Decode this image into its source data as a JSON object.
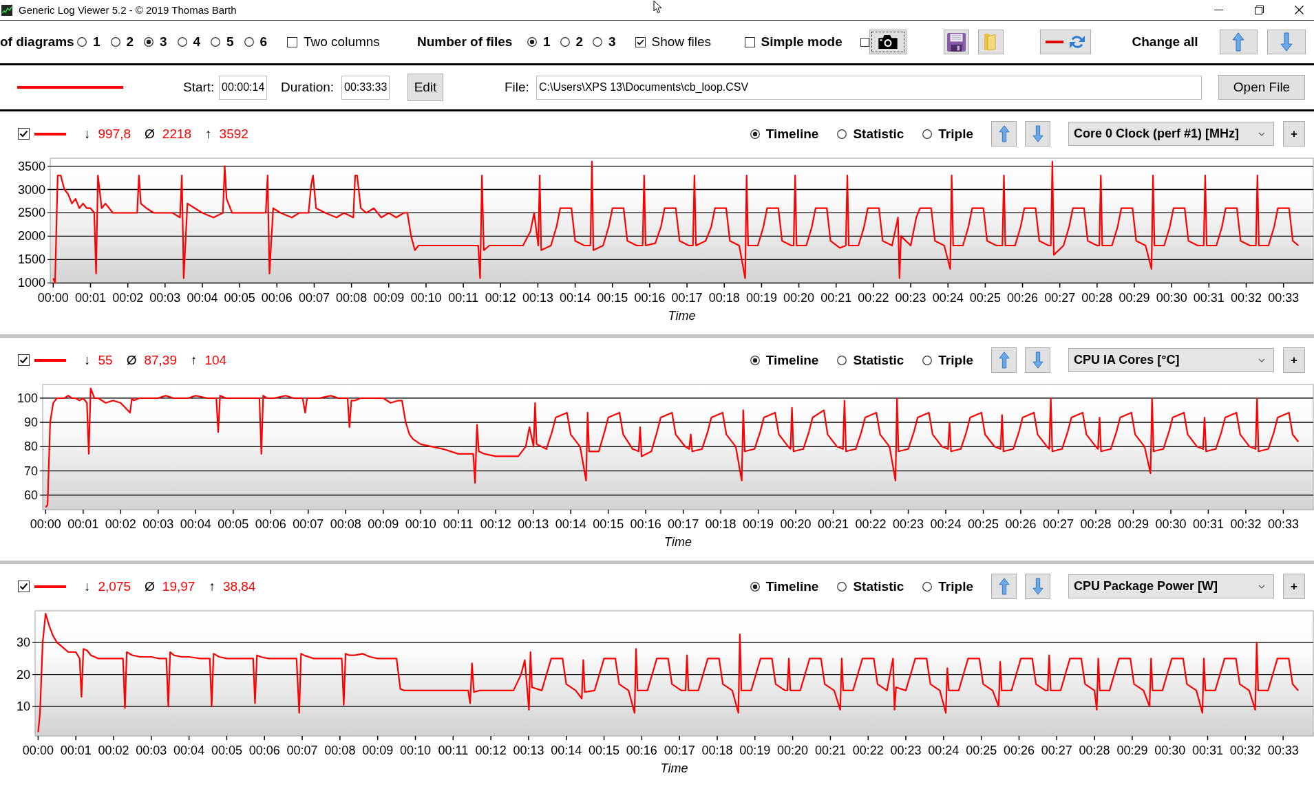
{
  "window": {
    "title": "Generic Log Viewer 5.2 - © 2019 Thomas Barth"
  },
  "toolbar": {
    "diagrams_label": "of diagrams",
    "diagram_counts": [
      {
        "label": "1",
        "selected": false
      },
      {
        "label": "2",
        "selected": false
      },
      {
        "label": "3",
        "selected": true
      },
      {
        "label": "4",
        "selected": false
      },
      {
        "label": "5",
        "selected": false
      },
      {
        "label": "6",
        "selected": false
      }
    ],
    "two_columns": {
      "label": "Two columns",
      "checked": false
    },
    "files_label": "Number of files",
    "file_counts": [
      {
        "label": "1",
        "selected": true
      },
      {
        "label": "2",
        "selected": false
      },
      {
        "label": "3",
        "selected": false
      }
    ],
    "show_files": {
      "label": "Show files",
      "checked": true
    },
    "simple_mode": {
      "label": "Simple mode",
      "checked": false
    },
    "screenshot": {
      "checked": false,
      "focused": true
    },
    "change_all_label": "Change all"
  },
  "files": [
    {
      "color": "#ff0000",
      "start_label": "Start:",
      "start": "00:00:14",
      "duration_label": "Duration:",
      "duration": "00:33:33",
      "edit_button": "Edit",
      "file_label": "File:",
      "path": "C:\\Users\\XPS 13\\Documents\\cb_loop.CSV",
      "open_button": "Open File"
    }
  ],
  "diagrams": [
    {
      "checked": true,
      "stats": [
        {
          "symbol": "↓",
          "value": "997,8"
        },
        {
          "symbol": "Ø",
          "value": "2218"
        },
        {
          "symbol": "↑",
          "value": "3592"
        }
      ],
      "modes": [
        {
          "label": "Timeline",
          "selected": true
        },
        {
          "label": "Statistic",
          "selected": false
        },
        {
          "label": "Triple",
          "selected": false
        }
      ],
      "sensor": "Core 0 Clock (perf #1) [MHz]",
      "add_button": "+",
      "chart_data": {
        "type": "line",
        "xlabel": "Time",
        "grid": true,
        "xlim": [
          -0.08,
          33.8
        ],
        "ylim": [
          990,
          3670
        ],
        "yticks": [
          1000,
          1500,
          2000,
          2500,
          3000,
          3500
        ],
        "xticks": [
          {
            "value": 0,
            "label": "00:00"
          },
          {
            "value": 1,
            "label": "00:01"
          },
          {
            "value": 2,
            "label": "00:02"
          },
          {
            "value": 3,
            "label": "00:03"
          },
          {
            "value": 4,
            "label": "00:04"
          },
          {
            "value": 5,
            "label": "00:05"
          },
          {
            "value": 6,
            "label": "00:06"
          },
          {
            "value": 7,
            "label": "00:07"
          },
          {
            "value": 8,
            "label": "00:08"
          },
          {
            "value": 9,
            "label": "00:09"
          },
          {
            "value": 10,
            "label": "00:10"
          },
          {
            "value": 11,
            "label": "00:11"
          },
          {
            "value": 12,
            "label": "00:12"
          },
          {
            "value": 13,
            "label": "00:13"
          },
          {
            "value": 14,
            "label": "00:14"
          },
          {
            "value": 15,
            "label": "00:15"
          },
          {
            "value": 16,
            "label": "00:16"
          },
          {
            "value": 17,
            "label": "00:17"
          },
          {
            "value": 18,
            "label": "00:18"
          },
          {
            "value": 19,
            "label": "00:19"
          },
          {
            "value": 20,
            "label": "00:20"
          },
          {
            "value": 21,
            "label": "00:21"
          },
          {
            "value": 22,
            "label": "00:22"
          },
          {
            "value": 23,
            "label": "00:23"
          },
          {
            "value": 24,
            "label": "00:24"
          },
          {
            "value": 25,
            "label": "00:25"
          },
          {
            "value": 26,
            "label": "00:26"
          },
          {
            "value": 27,
            "label": "00:27"
          },
          {
            "value": 28,
            "label": "00:28"
          },
          {
            "value": 29,
            "label": "00:29"
          },
          {
            "value": 30,
            "label": "00:30"
          },
          {
            "value": 31,
            "label": "00:31"
          },
          {
            "value": 32,
            "label": "00:32"
          },
          {
            "value": 33,
            "label": "00:33"
          }
        ],
        "x": [
          0,
          0.05,
          0.12,
          0.2,
          0.3,
          0.4,
          0.5,
          0.6,
          0.7,
          0.8,
          0.9,
          1,
          1.1,
          1.15,
          1.2,
          1.3,
          1.4,
          1.6,
          1.8,
          2,
          2.25,
          2.3,
          2.35,
          2.5,
          2.7,
          3,
          3.2,
          3.4,
          3.45,
          3.5,
          3.6,
          3.8,
          4,
          4.3,
          4.55,
          4.6,
          4.65,
          4.8,
          5,
          5.3,
          5.7,
          5.75,
          5.8,
          5.9,
          6.1,
          6.4,
          6.6,
          6.85,
          6.92,
          6.97,
          7.05,
          7.3,
          7.6,
          7.8,
          8.05,
          8.1,
          8.15,
          8.25,
          8.4,
          8.6,
          8.8,
          9,
          9.2,
          9.4,
          9.5,
          9.6,
          9.7,
          9.8,
          10,
          10.3,
          10.6,
          11,
          11.4,
          11.45,
          11.5,
          11.55,
          11.7,
          12,
          12.3,
          12.6,
          12.8,
          12.9,
          13.01,
          13.05,
          13.09,
          13.35,
          13.5,
          13.6,
          13.9,
          14,
          14.25,
          14.41,
          14.45,
          14.49,
          14.75,
          14.9,
          15,
          15.3,
          15.4,
          15.65,
          15.81,
          15.85,
          15.89,
          16.15,
          16.3,
          16.4,
          16.7,
          16.8,
          17.05,
          17.16,
          17.2,
          17.24,
          17.5,
          17.65,
          17.75,
          18.05,
          18.15,
          18.4,
          18.56,
          18.6,
          18.64,
          18.9,
          19.05,
          19.15,
          19.45,
          19.55,
          19.8,
          19.86,
          19.9,
          19.94,
          20.2,
          20.35,
          20.45,
          20.75,
          20.85,
          21.1,
          21.26,
          21.3,
          21.34,
          21.6,
          21.75,
          21.85,
          22.15,
          22.25,
          22.5,
          22.66,
          22.7,
          22.74,
          23,
          23.15,
          23.25,
          23.55,
          23.65,
          23.9,
          24.06,
          24.1,
          24.14,
          24.4,
          24.55,
          24.65,
          24.95,
          25.05,
          25.3,
          25.46,
          25.5,
          25.54,
          25.8,
          25.95,
          26.05,
          26.35,
          26.45,
          26.7,
          26.76,
          26.8,
          26.84,
          27.1,
          27.25,
          27.35,
          27.65,
          27.75,
          28,
          28.06,
          28.1,
          28.14,
          28.4,
          28.55,
          28.65,
          28.95,
          29.05,
          29.3,
          29.46,
          29.5,
          29.54,
          29.8,
          29.95,
          30.05,
          30.35,
          30.45,
          30.7,
          30.86,
          30.9,
          30.94,
          31.2,
          31.35,
          31.45,
          31.75,
          31.85,
          32.1,
          32.26,
          32.3,
          32.34,
          32.6,
          32.75,
          32.85,
          33.15,
          33.25,
          33.4
        ],
        "series": [
          {
            "color": "#ff0000",
            "values": [
              1100,
              1000,
              3300,
              3300,
              3000,
              2900,
              2700,
              2800,
              2600,
              2700,
              2600,
              2600,
              2500,
              1200,
              3300,
              2600,
              2700,
              2500,
              2500,
              2500,
              2500,
              3300,
              2700,
              2600,
              2500,
              2500,
              2500,
              2400,
              3300,
              1100,
              2700,
              2600,
              2500,
              2400,
              2500,
              3500,
              2800,
              2500,
              2500,
              2500,
              2500,
              3300,
              1200,
              2600,
              2500,
              2400,
              2500,
              2500,
              3100,
              3300,
              2600,
              2500,
              2400,
              2500,
              2400,
              3300,
              3300,
              2600,
              2500,
              2600,
              2400,
              2500,
              2400,
              2500,
              2500,
              2000,
              1700,
              1800,
              1800,
              1800,
              1800,
              1800,
              1800,
              1100,
              3300,
              1700,
              1800,
              1800,
              1800,
              1800,
              2100,
              2500,
              1800,
              3300,
              1700,
              1800,
              2200,
              2600,
              2600,
              1900,
              1800,
              1800,
              3600,
              1700,
              1800,
              2200,
              2600,
              2600,
              1900,
              1800,
              1800,
              3300,
              1800,
              1850,
              2200,
              2600,
              2600,
              1900,
              1800,
              1800,
              3300,
              1800,
              1900,
              2200,
              2600,
              2600,
              1900,
              1800,
              1100,
              3300,
              1800,
              1800,
              2200,
              2600,
              2600,
              1900,
              1800,
              1800,
              3300,
              1800,
              1800,
              2200,
              2600,
              2600,
              1900,
              1750,
              1800,
              3300,
              1800,
              1800,
              2200,
              2600,
              2600,
              1900,
              1800,
              2400,
              1100,
              2000,
              1800,
              2400,
              2600,
              2600,
              1900,
              1800,
              1300,
              3300,
              1800,
              1800,
              2200,
              2600,
              2600,
              1900,
              1800,
              1800,
              3300,
              1800,
              1800,
              2200,
              2600,
              2600,
              1900,
              1800,
              1800,
              3600,
              1600,
              1800,
              2200,
              2600,
              2600,
              1900,
              1800,
              1800,
              3300,
              1800,
              1800,
              2200,
              2600,
              2600,
              1900,
              1800,
              1300,
              3300,
              1800,
              1800,
              2200,
              2600,
              2600,
              1900,
              1800,
              1800,
              3300,
              1800,
              1800,
              2200,
              2600,
              2600,
              1900,
              1800,
              1800,
              3300,
              1800,
              1800,
              2200,
              2600,
              2600,
              1900,
              1800
            ]
          }
        ]
      }
    },
    {
      "checked": true,
      "stats": [
        {
          "symbol": "↓",
          "value": "55"
        },
        {
          "symbol": "Ø",
          "value": "87,39"
        },
        {
          "symbol": "↑",
          "value": "104"
        }
      ],
      "modes": [
        {
          "label": "Timeline",
          "selected": true
        },
        {
          "label": "Statistic",
          "selected": false
        },
        {
          "label": "Triple",
          "selected": false
        }
      ],
      "sensor": "CPU IA Cores [°C]",
      "add_button": "+",
      "chart_data": {
        "type": "line",
        "xlabel": "Time",
        "grid": true,
        "xlim": [
          -0.08,
          33.8
        ],
        "ylim": [
          54,
          105.6
        ],
        "yticks": [
          60,
          70,
          80,
          90,
          100
        ],
        "xticks": [
          {
            "value": 0,
            "label": "00:00"
          },
          {
            "value": 1,
            "label": "00:01"
          },
          {
            "value": 2,
            "label": "00:02"
          },
          {
            "value": 3,
            "label": "00:03"
          },
          {
            "value": 4,
            "label": "00:04"
          },
          {
            "value": 5,
            "label": "00:05"
          },
          {
            "value": 6,
            "label": "00:06"
          },
          {
            "value": 7,
            "label": "00:07"
          },
          {
            "value": 8,
            "label": "00:08"
          },
          {
            "value": 9,
            "label": "00:09"
          },
          {
            "value": 10,
            "label": "00:10"
          },
          {
            "value": 11,
            "label": "00:11"
          },
          {
            "value": 12,
            "label": "00:12"
          },
          {
            "value": 13,
            "label": "00:13"
          },
          {
            "value": 14,
            "label": "00:14"
          },
          {
            "value": 15,
            "label": "00:15"
          },
          {
            "value": 16,
            "label": "00:16"
          },
          {
            "value": 17,
            "label": "00:17"
          },
          {
            "value": 18,
            "label": "00:18"
          },
          {
            "value": 19,
            "label": "00:19"
          },
          {
            "value": 20,
            "label": "00:20"
          },
          {
            "value": 21,
            "label": "00:21"
          },
          {
            "value": 22,
            "label": "00:22"
          },
          {
            "value": 23,
            "label": "00:23"
          },
          {
            "value": 24,
            "label": "00:24"
          },
          {
            "value": 25,
            "label": "00:25"
          },
          {
            "value": 26,
            "label": "00:26"
          },
          {
            "value": 27,
            "label": "00:27"
          },
          {
            "value": 28,
            "label": "00:28"
          },
          {
            "value": 29,
            "label": "00:29"
          },
          {
            "value": 30,
            "label": "00:30"
          },
          {
            "value": 31,
            "label": "00:31"
          },
          {
            "value": 32,
            "label": "00:32"
          },
          {
            "value": 33,
            "label": "00:33"
          }
        ],
        "x": [
          0,
          0.05,
          0.12,
          0.2,
          0.3,
          0.4,
          0.5,
          0.6,
          0.7,
          0.8,
          0.9,
          1,
          1.1,
          1.15,
          1.2,
          1.3,
          1.4,
          1.6,
          1.8,
          2,
          2.25,
          2.3,
          2.35,
          2.5,
          2.7,
          3,
          3.2,
          3.4,
          3.45,
          3.5,
          3.6,
          3.8,
          4,
          4.3,
          4.55,
          4.6,
          4.65,
          4.8,
          5,
          5.3,
          5.7,
          5.75,
          5.8,
          5.9,
          6.1,
          6.4,
          6.6,
          6.85,
          6.92,
          6.97,
          7.05,
          7.3,
          7.6,
          7.8,
          8.05,
          8.1,
          8.15,
          8.25,
          8.4,
          8.6,
          8.8,
          9,
          9.2,
          9.4,
          9.5,
          9.6,
          9.7,
          9.8,
          10,
          10.3,
          10.6,
          11,
          11.4,
          11.45,
          11.5,
          11.55,
          11.7,
          12,
          12.3,
          12.6,
          12.8,
          12.9,
          13.01,
          13.05,
          13.09,
          13.35,
          13.5,
          13.6,
          13.9,
          14,
          14.25,
          14.41,
          14.45,
          14.49,
          14.75,
          14.9,
          15,
          15.3,
          15.4,
          15.65,
          15.81,
          15.85,
          15.89,
          16.15,
          16.3,
          16.4,
          16.7,
          16.8,
          17.05,
          17.16,
          17.2,
          17.24,
          17.5,
          17.65,
          17.75,
          18.05,
          18.15,
          18.4,
          18.56,
          18.6,
          18.64,
          18.9,
          19.05,
          19.15,
          19.45,
          19.55,
          19.8,
          19.86,
          19.9,
          19.94,
          20.2,
          20.35,
          20.45,
          20.75,
          20.85,
          21.1,
          21.26,
          21.3,
          21.34,
          21.6,
          21.75,
          21.85,
          22.15,
          22.25,
          22.5,
          22.66,
          22.7,
          22.74,
          23,
          23.15,
          23.25,
          23.55,
          23.65,
          23.9,
          24.06,
          24.1,
          24.14,
          24.4,
          24.55,
          24.65,
          24.95,
          25.05,
          25.3,
          25.46,
          25.5,
          25.54,
          25.8,
          25.95,
          26.05,
          26.35,
          26.45,
          26.7,
          26.76,
          26.8,
          26.84,
          27.1,
          27.25,
          27.35,
          27.65,
          27.75,
          28,
          28.06,
          28.1,
          28.14,
          28.4,
          28.55,
          28.65,
          28.95,
          29.05,
          29.3,
          29.46,
          29.5,
          29.54,
          29.8,
          29.95,
          30.05,
          30.35,
          30.45,
          30.7,
          30.86,
          30.9,
          30.94,
          31.2,
          31.35,
          31.45,
          31.75,
          31.85,
          32.1,
          32.26,
          32.3,
          32.34,
          32.6,
          32.75,
          32.85,
          33.15,
          33.25,
          33.4
        ],
        "series": [
          {
            "color": "#ff0000",
            "values": [
              55,
              56,
              90,
              98,
              100,
              100,
              100,
              101,
              100,
              100,
              99,
              100,
              98,
              77,
              104,
              100,
              100,
              98,
              99,
              98,
              94,
              100,
              99,
              100,
              100,
              100,
              101,
              100,
              100,
              100,
              100,
              100,
              101,
              100,
              100,
              86,
              101,
              100,
              100,
              100,
              100,
              77,
              101,
              100,
              100,
              101,
              100,
              100,
              94,
              100,
              100,
              100,
              101,
              100,
              100,
              88,
              99,
              99,
              100,
              100,
              100,
              100,
              98,
              99,
              99,
              90,
              85,
              83,
              81,
              80,
              79,
              77,
              77,
              65,
              89,
              78,
              77,
              76,
              76,
              76,
              80,
              88,
              80,
              98,
              81,
              79,
              86,
              92,
              94,
              85,
              80,
              66,
              94,
              78,
              78,
              86,
              92,
              94,
              85,
              79,
              78,
              88,
              76,
              78,
              86,
              92,
              94,
              85,
              80,
              79,
              85,
              78,
              79,
              86,
              92,
              94,
              85,
              80,
              66,
              95,
              78,
              79,
              86,
              92,
              94,
              85,
              80,
              79,
              96,
              78,
              79,
              86,
              92,
              95,
              85,
              80,
              79,
              99,
              78,
              79,
              86,
              92,
              94,
              85,
              80,
              66,
              100,
              78,
              79,
              86,
              92,
              94,
              85,
              80,
              79,
              90,
              78,
              79,
              86,
              92,
              94,
              85,
              80,
              79,
              93,
              78,
              79,
              86,
              92,
              94,
              85,
              80,
              79,
              100,
              78,
              79,
              86,
              92,
              94,
              85,
              80,
              79,
              92,
              78,
              79,
              86,
              92,
              94,
              85,
              80,
              69,
              100,
              78,
              79,
              86,
              92,
              94,
              85,
              80,
              79,
              92,
              78,
              79,
              86,
              92,
              94,
              85,
              80,
              79,
              100,
              78,
              79,
              86,
              92,
              94,
              85,
              82
            ]
          }
        ]
      }
    },
    {
      "checked": true,
      "stats": [
        {
          "symbol": "↓",
          "value": "2,075"
        },
        {
          "symbol": "Ø",
          "value": "19,97"
        },
        {
          "symbol": "↑",
          "value": "38,84"
        }
      ],
      "modes": [
        {
          "label": "Timeline",
          "selected": true
        },
        {
          "label": "Statistic",
          "selected": false
        },
        {
          "label": "Triple",
          "selected": false
        }
      ],
      "sensor": "CPU Package Power [W]",
      "add_button": "+",
      "chart_data": {
        "type": "line",
        "xlabel": "Time",
        "grid": true,
        "xlim": [
          -0.08,
          33.8
        ],
        "ylim": [
          0.8,
          39.9
        ],
        "yticks": [
          10,
          20,
          30
        ],
        "xticks": [
          {
            "value": 0,
            "label": "00:00"
          },
          {
            "value": 1,
            "label": "00:01"
          },
          {
            "value": 2,
            "label": "00:02"
          },
          {
            "value": 3,
            "label": "00:03"
          },
          {
            "value": 4,
            "label": "00:04"
          },
          {
            "value": 5,
            "label": "00:05"
          },
          {
            "value": 6,
            "label": "00:06"
          },
          {
            "value": 7,
            "label": "00:07"
          },
          {
            "value": 8,
            "label": "00:08"
          },
          {
            "value": 9,
            "label": "00:09"
          },
          {
            "value": 10,
            "label": "00:10"
          },
          {
            "value": 11,
            "label": "00:11"
          },
          {
            "value": 12,
            "label": "00:12"
          },
          {
            "value": 13,
            "label": "00:13"
          },
          {
            "value": 14,
            "label": "00:14"
          },
          {
            "value": 15,
            "label": "00:15"
          },
          {
            "value": 16,
            "label": "00:16"
          },
          {
            "value": 17,
            "label": "00:17"
          },
          {
            "value": 18,
            "label": "00:18"
          },
          {
            "value": 19,
            "label": "00:19"
          },
          {
            "value": 20,
            "label": "00:20"
          },
          {
            "value": 21,
            "label": "00:21"
          },
          {
            "value": 22,
            "label": "00:22"
          },
          {
            "value": 23,
            "label": "00:23"
          },
          {
            "value": 24,
            "label": "00:24"
          },
          {
            "value": 25,
            "label": "00:25"
          },
          {
            "value": 26,
            "label": "00:26"
          },
          {
            "value": 27,
            "label": "00:27"
          },
          {
            "value": 28,
            "label": "00:28"
          },
          {
            "value": 29,
            "label": "00:29"
          },
          {
            "value": 30,
            "label": "00:30"
          },
          {
            "value": 31,
            "label": "00:31"
          },
          {
            "value": 32,
            "label": "00:32"
          },
          {
            "value": 33,
            "label": "00:33"
          }
        ],
        "x": [
          0,
          0.05,
          0.12,
          0.2,
          0.3,
          0.4,
          0.5,
          0.6,
          0.7,
          0.8,
          0.9,
          1,
          1.1,
          1.15,
          1.2,
          1.3,
          1.4,
          1.6,
          1.8,
          2,
          2.25,
          2.3,
          2.35,
          2.5,
          2.7,
          3,
          3.2,
          3.4,
          3.45,
          3.5,
          3.6,
          3.8,
          4,
          4.3,
          4.55,
          4.6,
          4.65,
          4.8,
          5,
          5.3,
          5.7,
          5.75,
          5.8,
          5.9,
          6.1,
          6.4,
          6.6,
          6.85,
          6.92,
          6.97,
          7.05,
          7.3,
          7.6,
          7.8,
          8.05,
          8.1,
          8.15,
          8.25,
          8.4,
          8.6,
          8.8,
          9,
          9.2,
          9.4,
          9.5,
          9.6,
          9.7,
          9.8,
          10,
          10.3,
          10.6,
          11,
          11.4,
          11.45,
          11.5,
          11.55,
          11.7,
          12,
          12.3,
          12.6,
          12.8,
          12.9,
          13.01,
          13.05,
          13.09,
          13.35,
          13.5,
          13.6,
          13.9,
          14,
          14.25,
          14.41,
          14.45,
          14.49,
          14.75,
          14.9,
          15,
          15.3,
          15.4,
          15.65,
          15.81,
          15.85,
          15.89,
          16.15,
          16.3,
          16.4,
          16.7,
          16.8,
          17.05,
          17.16,
          17.2,
          17.24,
          17.5,
          17.65,
          17.75,
          18.05,
          18.15,
          18.4,
          18.56,
          18.6,
          18.64,
          18.9,
          19.05,
          19.15,
          19.45,
          19.55,
          19.8,
          19.86,
          19.9,
          19.94,
          20.2,
          20.35,
          20.45,
          20.75,
          20.85,
          21.1,
          21.26,
          21.3,
          21.34,
          21.6,
          21.75,
          21.85,
          22.15,
          22.25,
          22.5,
          22.66,
          22.7,
          22.74,
          23,
          23.15,
          23.25,
          23.55,
          23.65,
          23.9,
          24.06,
          24.1,
          24.14,
          24.4,
          24.55,
          24.65,
          24.95,
          25.05,
          25.3,
          25.46,
          25.5,
          25.54,
          25.8,
          25.95,
          26.05,
          26.35,
          26.45,
          26.7,
          26.76,
          26.8,
          26.84,
          27.1,
          27.25,
          27.35,
          27.65,
          27.75,
          28,
          28.06,
          28.1,
          28.14,
          28.4,
          28.55,
          28.65,
          28.95,
          29.05,
          29.3,
          29.46,
          29.5,
          29.54,
          29.8,
          29.95,
          30.05,
          30.35,
          30.45,
          30.7,
          30.86,
          30.9,
          30.94,
          31.2,
          31.35,
          31.45,
          31.75,
          31.85,
          32.1,
          32.26,
          32.3,
          32.34,
          32.6,
          32.75,
          32.85,
          33.15,
          33.25,
          33.4
        ],
        "series": [
          {
            "color": "#ff0000",
            "values": [
              2,
              8,
              30,
              39,
              35,
              32,
              30,
              29,
              28,
              27,
              27,
              27,
              25,
              13,
              28,
              27.5,
              26,
              25,
              25,
              25,
              25,
              9.5,
              27,
              26,
              25.5,
              25.5,
              25,
              25,
              10,
              27,
              26,
              25.5,
              25.5,
              25,
              25,
              10,
              26.5,
              25.5,
              25,
              25,
              25,
              11,
              26,
              25.5,
              25,
              25,
              25,
              25,
              8,
              26.5,
              26,
              25,
              25,
              25,
              25,
              10.5,
              26.5,
              26,
              26,
              26.5,
              25.5,
              25,
              25,
              25,
              25,
              15.5,
              15,
              15,
              15,
              15,
              15,
              15,
              15,
              11,
              23.5,
              14.5,
              15,
              15,
              15,
              15,
              20,
              24.5,
              9,
              27,
              16,
              15,
              21,
              25,
              25,
              17,
              15,
              12.5,
              24.5,
              14.5,
              15,
              21,
              25,
              25,
              17,
              15,
              8,
              28,
              15,
              15,
              21,
              25,
              25,
              17,
              15,
              15,
              26,
              15,
              15,
              21,
              25,
              25,
              17,
              15,
              8,
              32.5,
              15,
              15,
              21,
              25,
              25,
              17,
              15,
              15,
              25,
              15,
              15,
              21,
              25,
              25,
              17,
              15,
              9,
              25,
              15,
              15,
              21,
              25,
              25,
              17,
              15,
              25,
              9,
              16,
              15,
              21,
              25,
              25,
              17,
              15,
              8,
              22,
              15,
              15,
              21,
              25,
              25,
              17,
              15,
              10,
              24,
              15,
              15,
              21,
              25,
              25,
              17,
              15,
              15,
              26,
              15,
              15,
              21,
              25,
              25,
              17,
              15,
              9,
              25,
              15,
              15,
              21,
              25,
              25,
              17,
              15,
              10,
              25,
              15,
              15,
              21,
              25,
              25,
              17,
              15,
              8,
              25,
              15,
              15,
              21,
              25,
              25,
              17,
              15,
              9,
              30,
              15,
              15,
              21,
              25,
              25,
              17,
              15
            ]
          }
        ]
      }
    }
  ]
}
